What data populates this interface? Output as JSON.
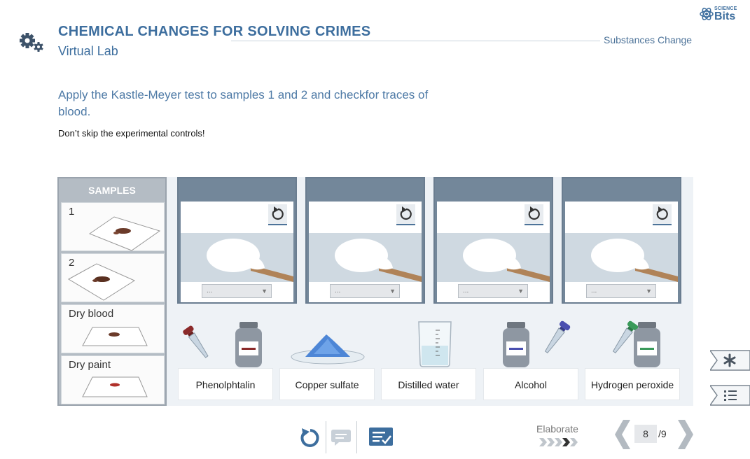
{
  "header": {
    "title": "CHEMICAL CHANGES FOR SOLVING CRIMES",
    "subtitle": "Virtual Lab",
    "section": "Substances Change"
  },
  "logo": {
    "top": "SCIENCE",
    "name": "Bits"
  },
  "instructions": {
    "text": "Apply the Kastle-Meyer test to samples 1 and 2 and checkfor traces of blood.",
    "note": "Don’t skip the experimental controls!"
  },
  "samples": {
    "title": "SAMPLES",
    "items": [
      {
        "label": "1"
      },
      {
        "label": "2"
      },
      {
        "label": "Dry blood"
      },
      {
        "label": "Dry paint"
      }
    ]
  },
  "stations": [
    {
      "select_value": "..."
    },
    {
      "select_value": "..."
    },
    {
      "select_value": "..."
    },
    {
      "select_value": "..."
    }
  ],
  "reagents": [
    {
      "label": "Phenolphtalin",
      "icon": "dropper-bottle-icon",
      "color": "#8b2a2a"
    },
    {
      "label": "Copper sulfate",
      "icon": "powder-dish-icon",
      "color": "#4d86d6"
    },
    {
      "label": "Distilled water",
      "icon": "beaker-icon",
      "color": "#cfe6ef"
    },
    {
      "label": "Alcohol",
      "icon": "dropper-bottle-icon",
      "color": "#4a4fb0"
    },
    {
      "label": "Hydrogen peroxide",
      "icon": "dropper-bottle-icon",
      "color": "#3a9a5a"
    }
  ],
  "footer": {
    "stage": "Elaborate",
    "page_current": "8",
    "page_total": "/9"
  },
  "colors": {
    "accent": "#3d6e9e",
    "station": "#73879a"
  }
}
